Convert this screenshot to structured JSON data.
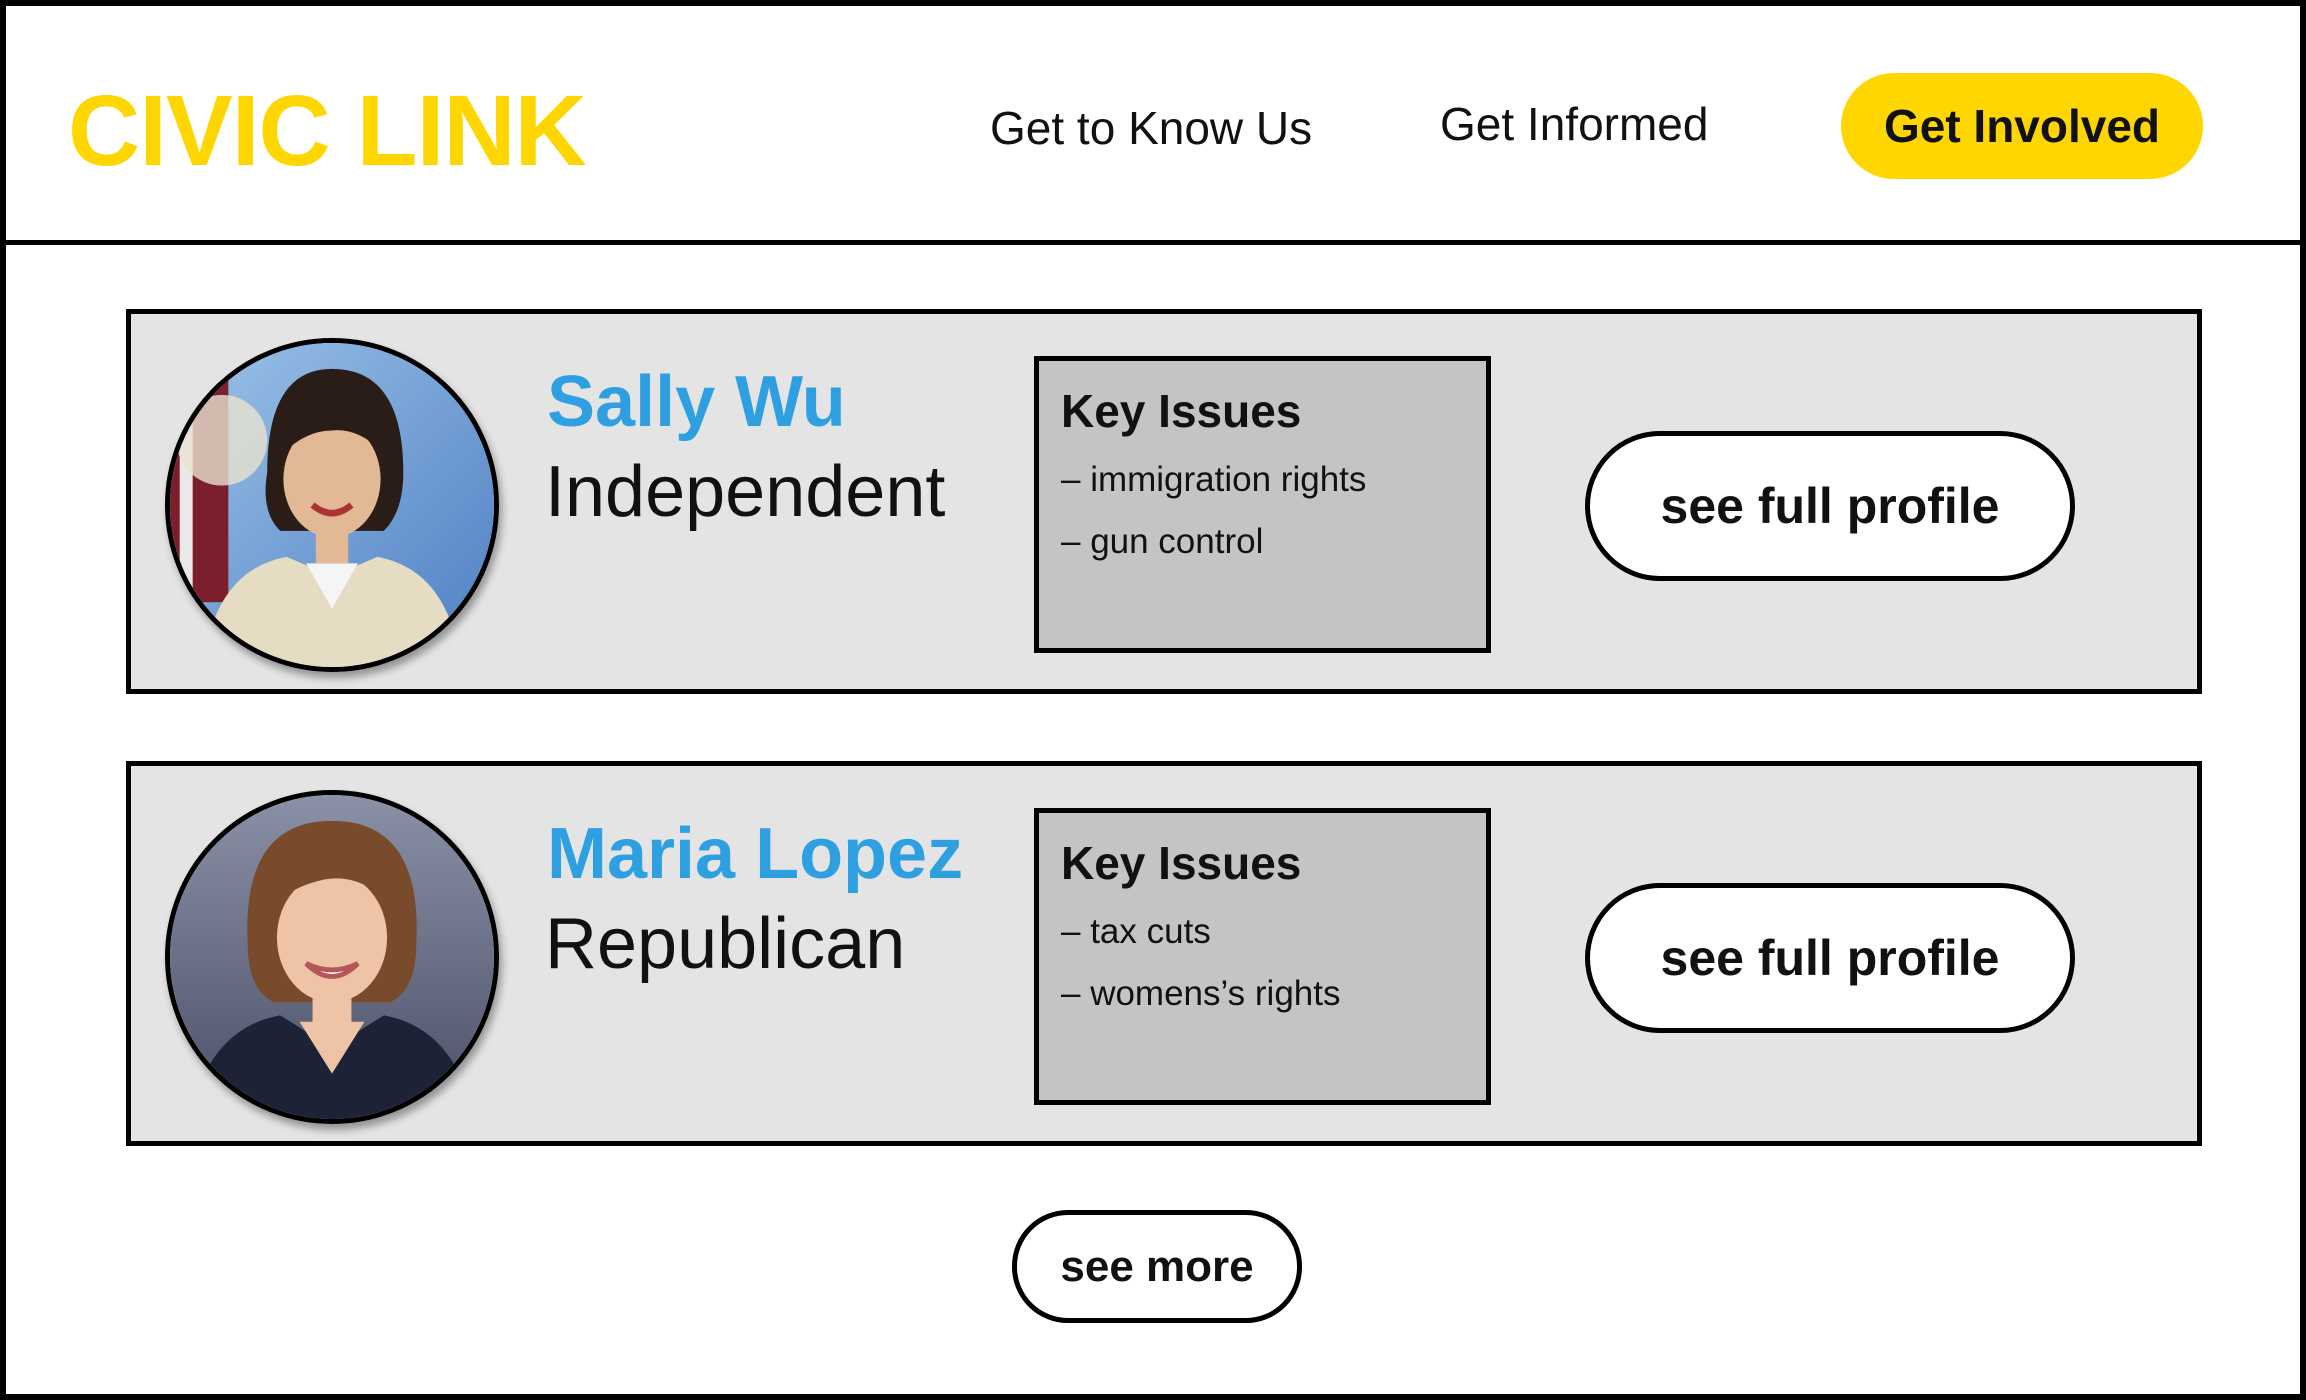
{
  "header": {
    "brand": "CIVIC LINK",
    "nav": {
      "know_us": "Get to Know Us",
      "informed": "Get Informed",
      "involved": "Get Involved"
    }
  },
  "colors": {
    "brand_yellow": "#FFD600",
    "name_blue": "#2E9FE0",
    "card_bg": "#e4e4e4",
    "issues_bg": "#c4c4c4"
  },
  "candidates": [
    {
      "name": "Sally Wu",
      "party": "Independent",
      "issues_title": "Key Issues",
      "issues": [
        "– immigration rights",
        "– gun control"
      ],
      "profile_button": "see full profile",
      "photo_icon": "candidate-photo"
    },
    {
      "name": "Maria Lopez",
      "party": "Republican",
      "issues_title": "Key Issues",
      "issues": [
        "– tax cuts",
        "– womens’s rights"
      ],
      "profile_button": "see full profile",
      "photo_icon": "candidate-photo"
    }
  ],
  "see_more": "see more"
}
